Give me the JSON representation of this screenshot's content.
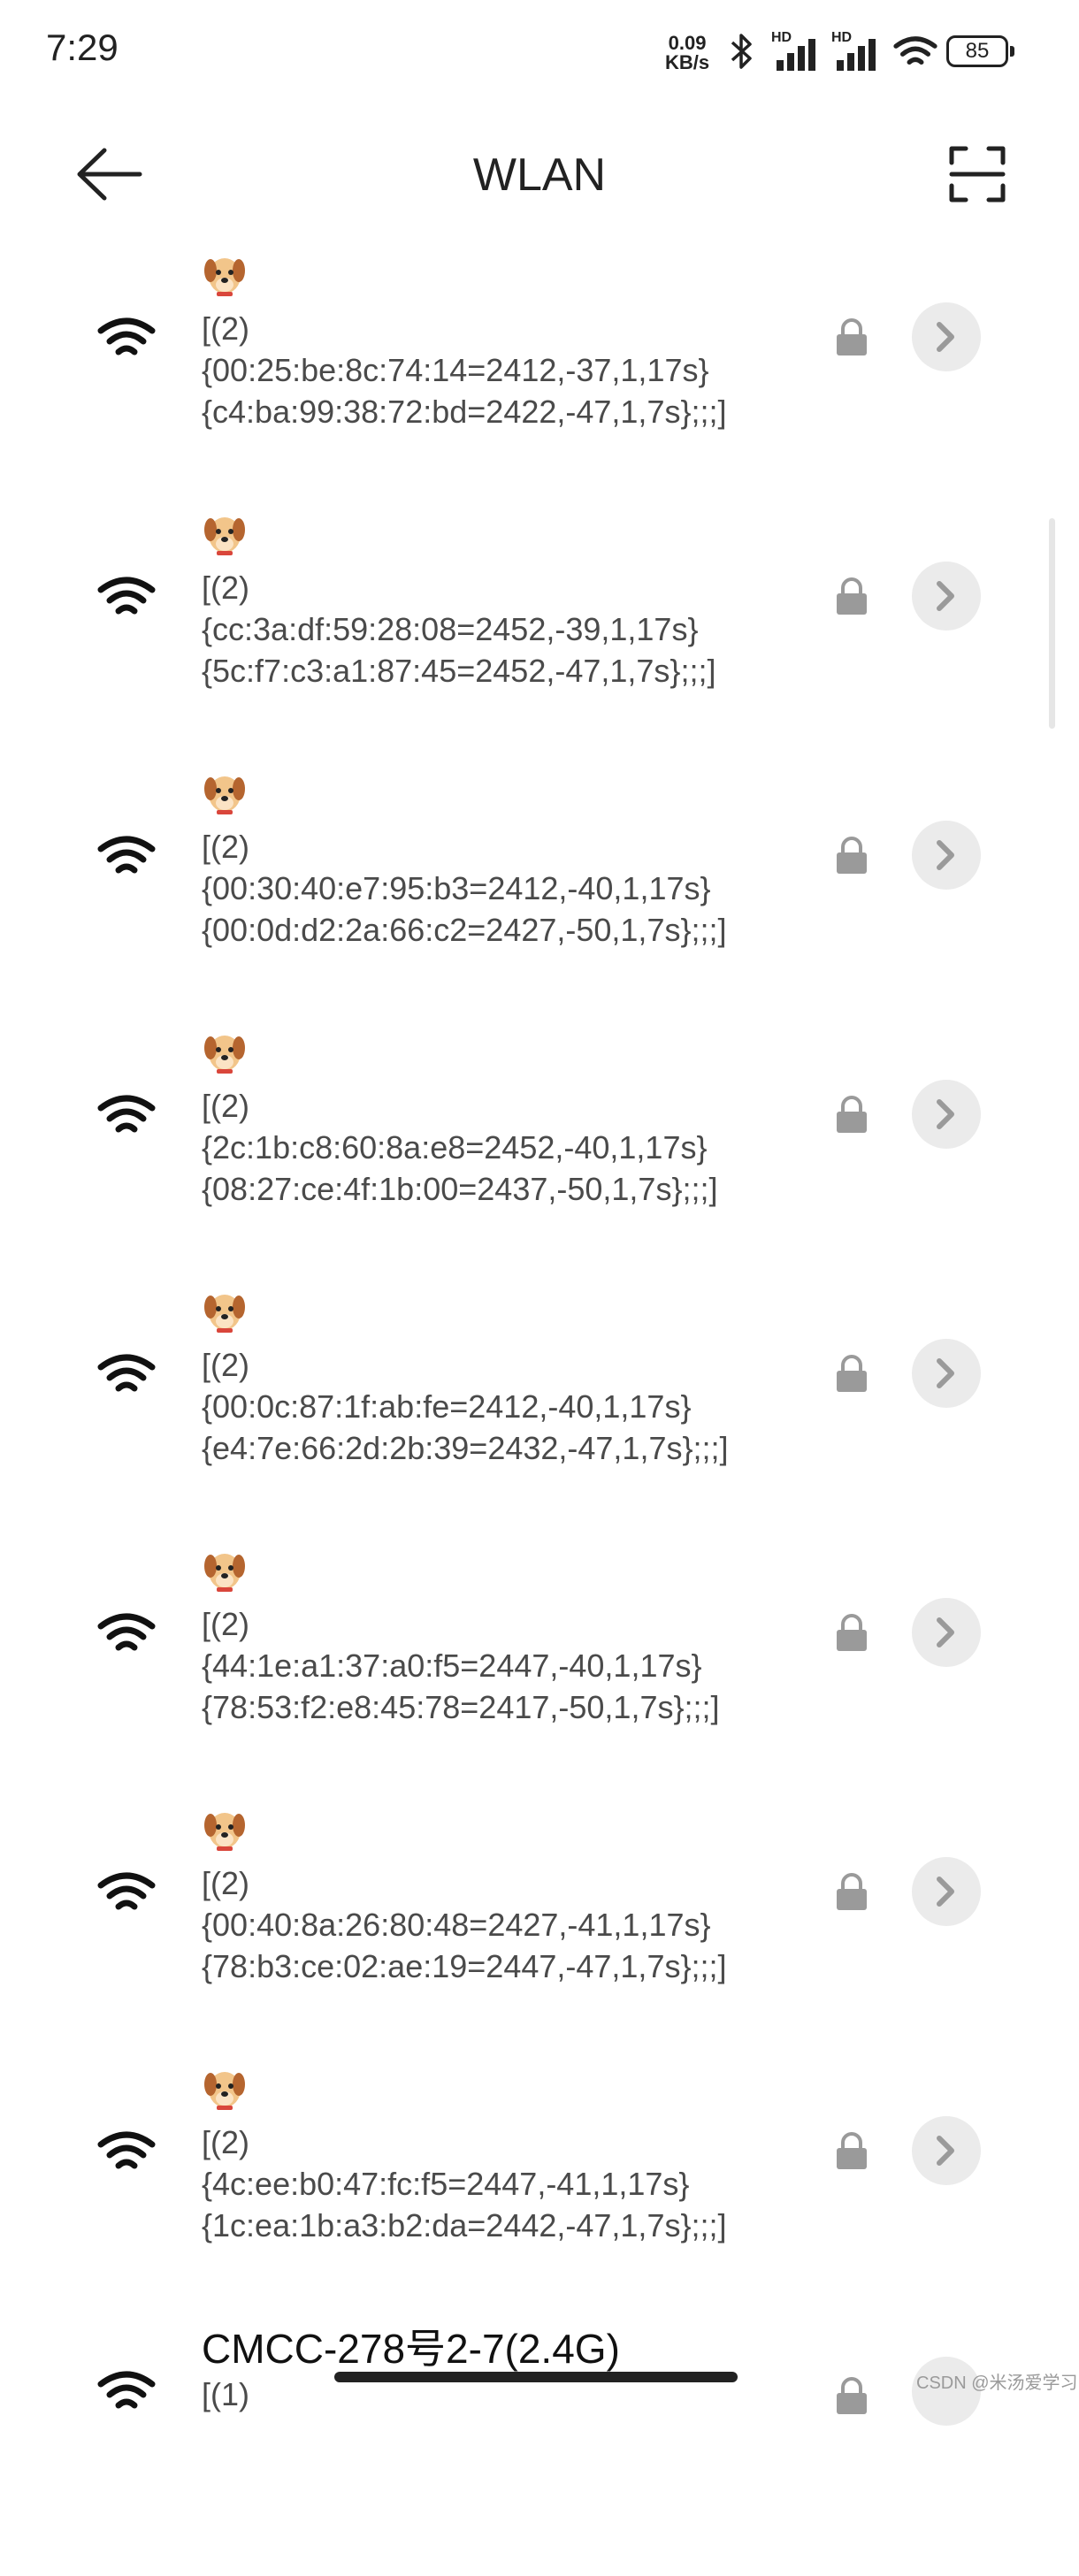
{
  "status_bar": {
    "time": "7:29",
    "speed_value": "0.09",
    "speed_unit": "KB/s",
    "signal1_label": "HD",
    "signal2_label": "HD",
    "battery": "85"
  },
  "header": {
    "title": "WLAN",
    "back_icon": "back-arrow-icon",
    "scan_icon": "scan-qr-icon"
  },
  "networks": [
    {
      "prefix": "[(2)",
      "line1": "{00:25:be:8c:74:14=2412,-37,1,17s}",
      "line2": "{c4:ba:99:38:72:bd=2422,-47,1,7s};;;]"
    },
    {
      "prefix": "[(2)",
      "line1": "{cc:3a:df:59:28:08=2452,-39,1,17s}",
      "line2": "{5c:f7:c3:a1:87:45=2452,-47,1,7s};;;]"
    },
    {
      "prefix": "[(2)",
      "line1": "{00:30:40:e7:95:b3=2412,-40,1,17s}",
      "line2": "{00:0d:d2:2a:66:c2=2427,-50,1,7s};;;]"
    },
    {
      "prefix": "[(2)",
      "line1": "{2c:1b:c8:60:8a:e8=2452,-40,1,17s}",
      "line2": "{08:27:ce:4f:1b:00=2437,-50,1,7s};;;]"
    },
    {
      "prefix": "[(2)",
      "line1": "{00:0c:87:1f:ab:fe=2412,-40,1,17s}",
      "line2": "{e4:7e:66:2d:2b:39=2432,-47,1,7s};;;]"
    },
    {
      "prefix": "[(2)",
      "line1": "{44:1e:a1:37:a0:f5=2447,-40,1,17s}",
      "line2": "{78:53:f2:e8:45:78=2417,-50,1,7s};;;]"
    },
    {
      "prefix": "[(2)",
      "line1": "{00:40:8a:26:80:48=2427,-41,1,17s}",
      "line2": "{78:b3:ce:02:ae:19=2447,-47,1,7s};;;]"
    },
    {
      "prefix": "[(2)",
      "line1": "{4c:ee:b0:47:fc:f5=2447,-41,1,17s}",
      "line2": "{1c:ea:1b:a3:b2:da=2442,-47,1,7s};;;]"
    }
  ],
  "last_network": {
    "name": "CMCC-278号2-7(2.4G)",
    "prefix": "[(1)"
  },
  "watermark": "CSDN @米汤爱学习",
  "colors": {
    "background": "#ffffff",
    "text": "#4a4a4a",
    "lock": "#9a9a9a",
    "detail_button": "#ebebeb"
  }
}
